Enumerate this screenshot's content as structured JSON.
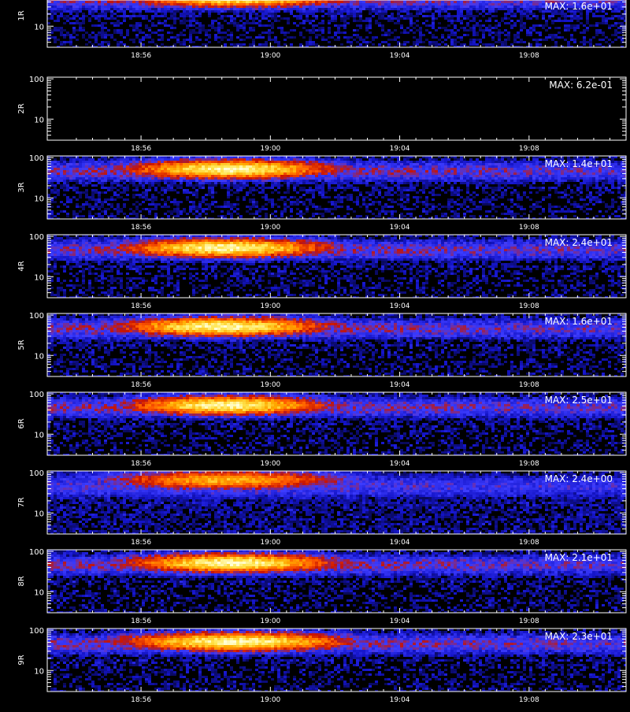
{
  "chart_data": {
    "type": "heatmap",
    "colormap": [
      "#000000",
      "#1414c8",
      "#3c3cff",
      "#c81400",
      "#ff5a00",
      "#ffaa00",
      "#ffe650",
      "#ffffdc"
    ],
    "x_tick_labels": [
      "18:56",
      "19:00",
      "19:04",
      "19:08"
    ],
    "x_tick_minutes": [
      896,
      900,
      904,
      908
    ],
    "xlim_minutes": [
      893.1,
      911.0
    ],
    "y_scale": "log",
    "ylim": [
      3,
      110
    ],
    "y_tick_labels": [
      "100",
      "10"
    ],
    "y_tick_values": [
      100,
      10
    ],
    "grid": false,
    "panels": [
      {
        "label": "1R",
        "max_text": "MAX: 1.6e+01",
        "max": 16,
        "center_minute": 898.9,
        "width_minutes": 2.1,
        "center_y": 55,
        "strength": 1.0
      },
      {
        "label": "2R",
        "max_text": "MAX: 6.2e-01",
        "max": 0.62,
        "center_minute": 898.9,
        "width_minutes": 2.1,
        "center_y": 55,
        "strength": 0.0
      },
      {
        "label": "3R",
        "max_text": "MAX: 1.4e+01",
        "max": 14,
        "center_minute": 898.7,
        "width_minutes": 2.0,
        "center_y": 55,
        "strength": 1.0
      },
      {
        "label": "4R",
        "max_text": "MAX: 2.4e+01",
        "max": 24,
        "center_minute": 898.6,
        "width_minutes": 2.0,
        "center_y": 55,
        "strength": 1.0
      },
      {
        "label": "5R",
        "max_text": "MAX: 1.6e+01",
        "max": 16,
        "center_minute": 898.5,
        "width_minutes": 2.0,
        "center_y": 55,
        "strength": 1.0
      },
      {
        "label": "6R",
        "max_text": "MAX: 2.5e+01",
        "max": 25,
        "center_minute": 898.6,
        "width_minutes": 1.9,
        "center_y": 55,
        "strength": 1.0
      },
      {
        "label": "7R",
        "max_text": "MAX: 2.4e+00",
        "max": 2.4,
        "center_minute": 898.6,
        "width_minutes": 2.2,
        "center_y": 70,
        "strength": 0.75
      },
      {
        "label": "8R",
        "max_text": "MAX: 2.1e+01",
        "max": 21,
        "center_minute": 898.8,
        "width_minutes": 2.0,
        "center_y": 55,
        "strength": 1.0
      },
      {
        "label": "9R",
        "max_text": "MAX: 2.3e+01",
        "max": 23,
        "center_minute": 898.9,
        "width_minutes": 2.2,
        "center_y": 55,
        "strength": 1.0
      }
    ]
  }
}
